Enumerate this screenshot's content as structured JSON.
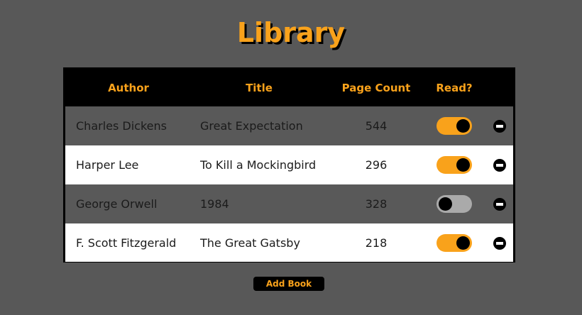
{
  "title": "Library",
  "table": {
    "headers": {
      "author": "Author",
      "title": "Title",
      "pages": "Page Count",
      "read": "Read?"
    },
    "rows": [
      {
        "author": "Charles Dickens",
        "title": "Great Expectation",
        "pages": "544",
        "read": true
      },
      {
        "author": "Harper Lee",
        "title": "To Kill a Mockingbird",
        "pages": "296",
        "read": true
      },
      {
        "author": "George Orwell",
        "title": "1984",
        "pages": "328",
        "read": false
      },
      {
        "author": "F. Scott Fitzgerald",
        "title": "The Great Gatsby",
        "pages": "218",
        "read": true
      }
    ],
    "row_icons": {
      "read": "toggle-switch",
      "remove": "minus-circle-icon"
    }
  },
  "add_button_label": "Add Book",
  "colors": {
    "accent": "#f9a21b",
    "background": "#585858",
    "header": "#000000",
    "row_dark": "#595959",
    "row_light": "#ffffff",
    "toggle_off": "#aaaaaa"
  }
}
